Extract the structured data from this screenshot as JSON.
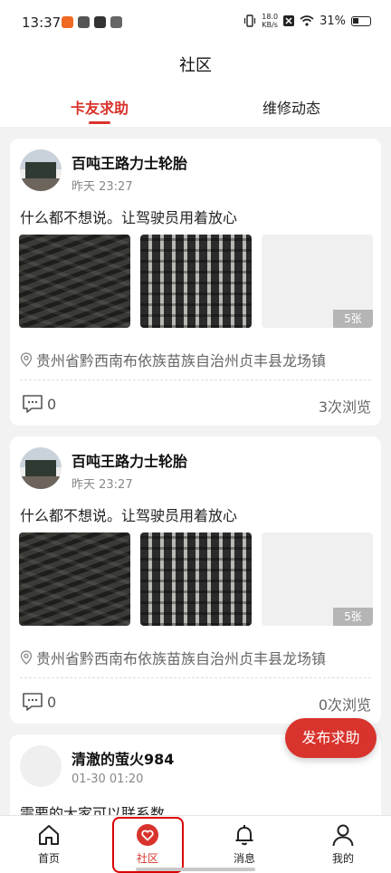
{
  "status_bar": {
    "time": "13:37",
    "net_speed_value": "18.0",
    "net_speed_unit": "KB/s",
    "battery": "31%"
  },
  "header": {
    "title": "社区",
    "tabs": [
      {
        "label": "卡友求助",
        "active": true
      },
      {
        "label": "维修动态",
        "active": false
      }
    ]
  },
  "posts": [
    {
      "username": "百吨王路力士轮胎",
      "time": "昨天 23:27",
      "text": "什么都不想说。让驾驶员用着放心",
      "images_more": "5张",
      "location": "贵州省黔西南布依族苗族自治州贞丰县龙场镇",
      "comments": "0",
      "views": "3次浏览"
    },
    {
      "username": "百吨王路力士轮胎",
      "time": "昨天 23:27",
      "text": "什么都不想说。让驾驶员用着放心",
      "images_more": "5张",
      "location": "贵州省黔西南布依族苗族自治州贞丰县龙场镇",
      "comments": "0",
      "views": "0次浏览"
    },
    {
      "username": "清澈的萤火984",
      "time": "01-30 01:20",
      "text": "需要的大家可以联系数"
    }
  ],
  "fab_label": "发布求助",
  "tabbar": [
    {
      "label": "首页",
      "icon": "home-icon"
    },
    {
      "label": "社区",
      "icon": "heart-icon",
      "active": true
    },
    {
      "label": "消息",
      "icon": "bell-icon"
    },
    {
      "label": "我的",
      "icon": "user-icon"
    }
  ],
  "colors": {
    "accent": "#d8332c",
    "background": "#f2f2f2"
  }
}
